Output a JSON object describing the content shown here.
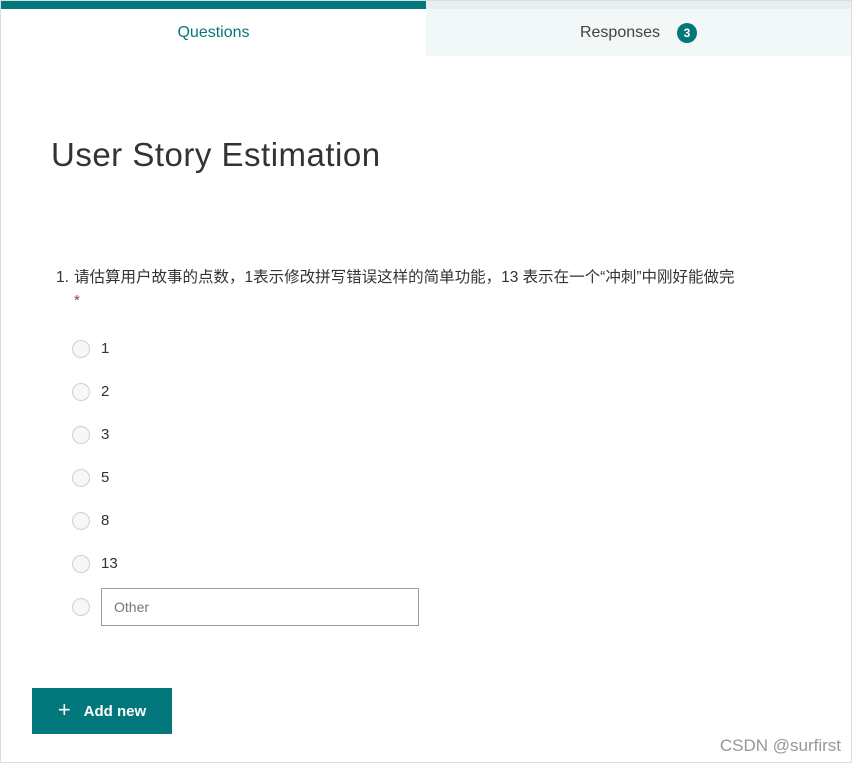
{
  "colors": {
    "accent": "#03787c",
    "required_marker": "#a4373a",
    "responses_tab_bg": "#f2f7f7",
    "text_main": "#333333"
  },
  "tabs": {
    "questions_label": "Questions",
    "responses_label": "Responses",
    "responses_count": "3"
  },
  "form": {
    "title": "User Story Estimation",
    "question": {
      "number": "1.",
      "text": "请估算用户故事的点数，1表示修改拼写错误这样的简单功能，13 表示在一个“冲刺”中刚好能做完",
      "required_marker": "*",
      "options": [
        "1",
        "2",
        "3",
        "5",
        "8",
        "13"
      ],
      "other_placeholder": "Other"
    }
  },
  "toolbar": {
    "add_new_label": "Add new",
    "plus_icon": "+"
  },
  "watermark": "CSDN @surfirst"
}
